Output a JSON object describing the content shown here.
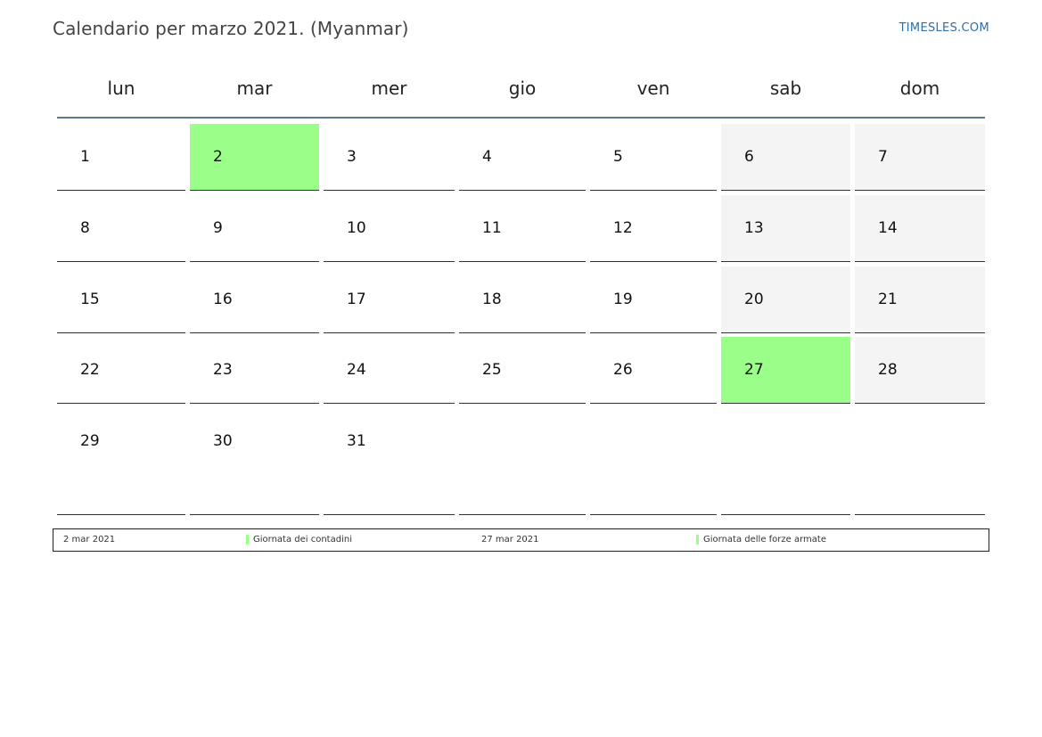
{
  "header": {
    "title": "Calendario per marzo 2021. (Myanmar)",
    "site": "TIMESLES.COM"
  },
  "weekdays": [
    "lun",
    "mar",
    "mer",
    "gio",
    "ven",
    "sab",
    "dom"
  ],
  "weeks": [
    [
      "1",
      "2",
      "3",
      "4",
      "5",
      "6",
      "7"
    ],
    [
      "8",
      "9",
      "10",
      "11",
      "12",
      "13",
      "14"
    ],
    [
      "15",
      "16",
      "17",
      "18",
      "19",
      "20",
      "21"
    ],
    [
      "22",
      "23",
      "24",
      "25",
      "26",
      "27",
      "28"
    ],
    [
      "29",
      "30",
      "31",
      "",
      "",
      "",
      ""
    ]
  ],
  "highlight_days": [
    "2",
    "27"
  ],
  "colors": {
    "holiday": "#99ff88",
    "weekend": "#f4f4f4",
    "header_rule": "#5b7797",
    "link": "#2e6fa7"
  },
  "legend": [
    {
      "date": "2 mar 2021",
      "name": "Giornata dei contadini"
    },
    {
      "date": "27 mar 2021",
      "name": "Giornata delle forze armate"
    }
  ]
}
